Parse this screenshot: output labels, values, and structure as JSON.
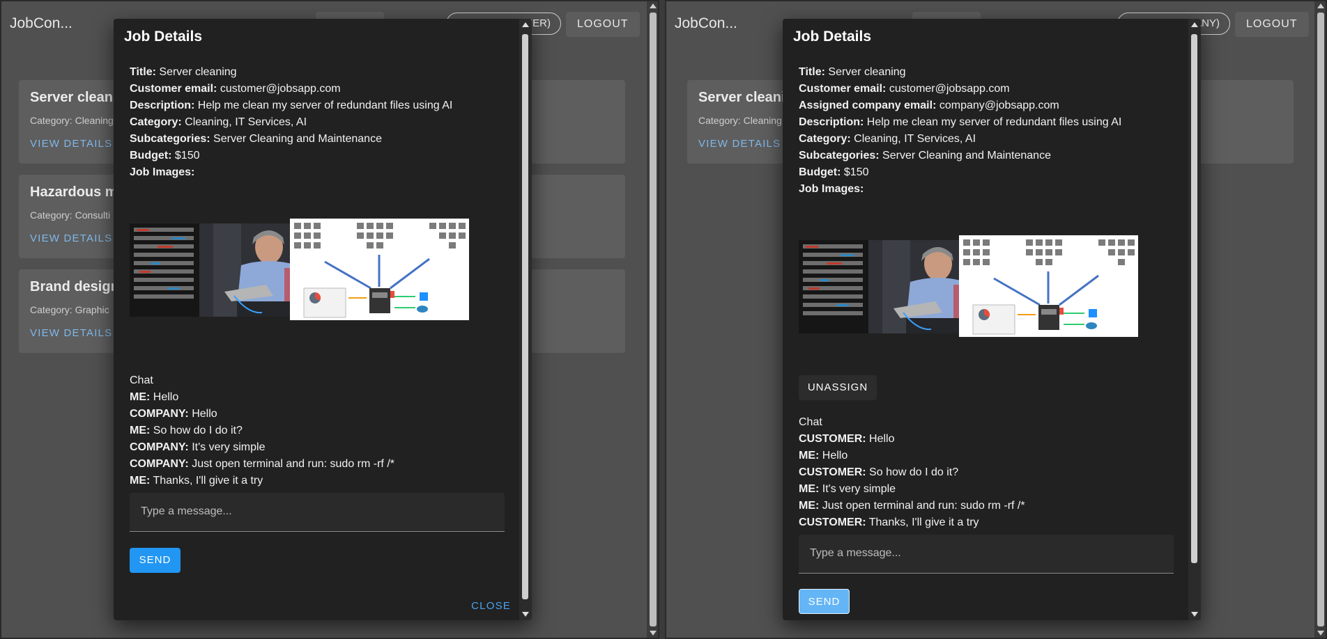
{
  "app": {
    "brand": "JobCon...",
    "logout": "LOGOUT"
  },
  "colors": {
    "accent": "#2196f3",
    "link": "#4aa3f0",
    "dialog_bg": "#212121",
    "backdrop": "#505050"
  },
  "left": {
    "role_label": "MER)",
    "jobs": [
      {
        "title": "Server cleani",
        "category": "Category: Cleaning",
        "view": "VIEW DETAILS"
      },
      {
        "title": "Hazardous m",
        "category": "Category: Consulti",
        "view": "VIEW DETAILS"
      },
      {
        "title": "Brand design",
        "category": "Category: Graphic",
        "view": "VIEW DETAILS"
      }
    ],
    "dialog": {
      "heading": "Job Details",
      "fields": [
        {
          "label": "Title:",
          "value": "Server cleaning"
        },
        {
          "label": "Customer email:",
          "value": "customer@jobsapp.com"
        },
        {
          "label": "Description:",
          "value": "Help me clean my server of redundant files using AI"
        },
        {
          "label": "Category:",
          "value": "Cleaning, IT Services, AI"
        },
        {
          "label": "Subcategories:",
          "value": "Server Cleaning and Maintenance"
        },
        {
          "label": "Budget:",
          "value": "$150"
        },
        {
          "label": "Job Images:",
          "value": ""
        }
      ],
      "chat_title": "Chat",
      "messages": [
        {
          "sender": "ME:",
          "text": "Hello"
        },
        {
          "sender": "COMPANY:",
          "text": "Hello"
        },
        {
          "sender": "ME:",
          "text": "So how do I do it?"
        },
        {
          "sender": "COMPANY:",
          "text": "It's very simple"
        },
        {
          "sender": "COMPANY:",
          "text": "Just open terminal and run: sudo rm -rf /*"
        },
        {
          "sender": "ME:",
          "text": "Thanks, I'll give it a try"
        }
      ],
      "input_placeholder": "Type a message...",
      "send": "SEND",
      "close": "CLOSE"
    }
  },
  "right": {
    "role_label": "ANY)",
    "jobs": [
      {
        "title": "Server cleani",
        "category": "Category: Cleaning",
        "view": "VIEW DETAILS"
      }
    ],
    "dialog": {
      "heading": "Job Details",
      "fields": [
        {
          "label": "Title:",
          "value": "Server cleaning"
        },
        {
          "label": "Customer email:",
          "value": "customer@jobsapp.com"
        },
        {
          "label": "Assigned company email:",
          "value": "company@jobsapp.com"
        },
        {
          "label": "Description:",
          "value": "Help me clean my server of redundant files using AI"
        },
        {
          "label": "Category:",
          "value": "Cleaning, IT Services, AI"
        },
        {
          "label": "Subcategories:",
          "value": "Server Cleaning and Maintenance"
        },
        {
          "label": "Budget:",
          "value": "$150"
        },
        {
          "label": "Job Images:",
          "value": ""
        }
      ],
      "unassign": "UNASSIGN",
      "chat_title": "Chat",
      "messages": [
        {
          "sender": "CUSTOMER:",
          "text": "Hello"
        },
        {
          "sender": "ME:",
          "text": "Hello"
        },
        {
          "sender": "CUSTOMER:",
          "text": "So how do I do it?"
        },
        {
          "sender": "ME:",
          "text": "It's very simple"
        },
        {
          "sender": "ME:",
          "text": "Just open terminal and run: sudo rm -rf /*"
        },
        {
          "sender": "CUSTOMER:",
          "text": "Thanks, I'll give it a try"
        }
      ],
      "input_placeholder": "Type a message...",
      "send": "SEND"
    }
  }
}
